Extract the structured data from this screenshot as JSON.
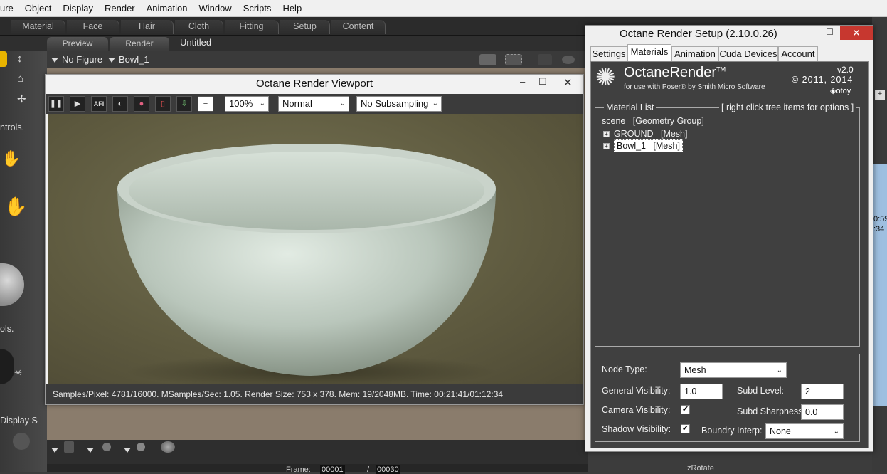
{
  "menu": [
    "ure",
    "Object",
    "Display",
    "Render",
    "Animation",
    "Window",
    "Scripts",
    "Help"
  ],
  "room_tabs": [
    "Material",
    "Face",
    "Hair",
    "Cloth",
    "Fitting",
    "Setup",
    "Content"
  ],
  "doc_tabs": {
    "preview": "Preview",
    "render": "Render",
    "document": "Untitled"
  },
  "figure_bar": {
    "figure": "No Figure",
    "actor": "Bowl_1"
  },
  "left_panel": {
    "controls1": "ntrols.",
    "controls2": "ols.",
    "display": "Display S"
  },
  "right_strip": {
    "t1": "0:59",
    "t2": ":34"
  },
  "viewport": {
    "title": "Octane Render Viewport",
    "zoom": "100%",
    "mode": "Normal",
    "subsampling": "No Subsampling",
    "afi_label": "AFI",
    "status": "Samples/Pixel: 4781/16000. MSamples/Sec: 1.05. Render Size: 753 x 378. Mem: 19/2048MB. Time: 00:21:41/01:12:34"
  },
  "setup": {
    "title": "Octane Render Setup (2.10.0.26)",
    "tabs": [
      "Settings",
      "Materials",
      "Animation",
      "Cuda Devices",
      "Account"
    ],
    "active_tab": "Materials",
    "logo": {
      "brand_a": "Octane",
      "brand_b": "Render",
      "tm": "TM",
      "sub": "for use with Poser® by Smith Micro Software",
      "version": "v2.0",
      "copyright": "© 2011, 2014",
      "maker": "otoy"
    },
    "material_list": {
      "legend": "Material List",
      "hint": "[ right click tree items for options ]",
      "scene": "scene   [Geometry Group]",
      "items": [
        "GROUND   [Mesh]",
        "Bowl_1   [Mesh]"
      ]
    },
    "props": {
      "node_type_label": "Node Type:",
      "node_type": "Mesh",
      "general_vis_label": "General Visibility:",
      "general_vis": "1.0",
      "subd_level_label": "Subd Level:",
      "subd_level": "2",
      "camera_vis_label": "Camera Visibility:",
      "subd_sharp_label": "Subd Sharpness:",
      "subd_sharp": "0.0",
      "shadow_vis_label": "Shadow Visibility:",
      "boundary_label": "Boundry Interp:",
      "boundary": "None"
    }
  },
  "bottom": {
    "frame_label": "Frame:",
    "frame": "00001",
    "of": "/",
    "total": "00030",
    "zrotate": "zRotate"
  },
  "colors": {
    "close": "#c7372f",
    "render_bg": "#5e5a3f",
    "bowl": "#c4cfc5"
  }
}
